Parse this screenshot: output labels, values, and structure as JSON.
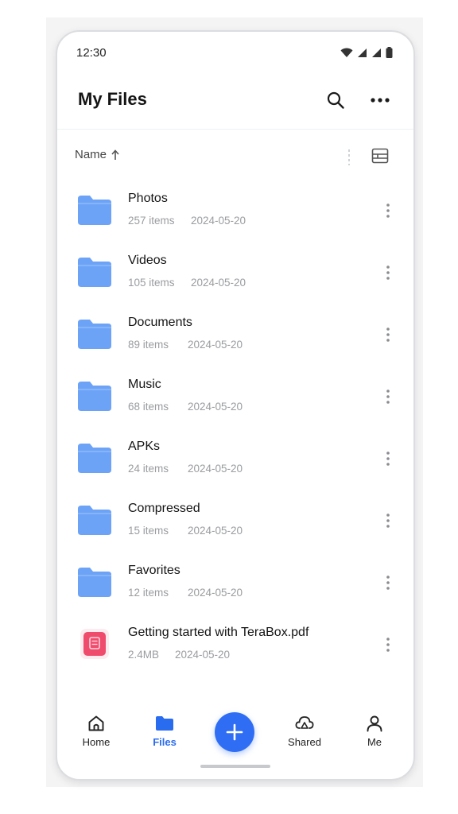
{
  "status_bar": {
    "time": "12:30",
    "icons": [
      "wifi-icon",
      "signal-icon",
      "signal-icon",
      "battery-icon"
    ]
  },
  "header": {
    "title": "My Files",
    "icons": [
      "search-icon",
      "more-horizontal-icon"
    ]
  },
  "sort": {
    "label": "Name",
    "direction_icon": "arrow-up-icon",
    "view_icon": "list-view-icon"
  },
  "files": [
    {
      "name": "Photos",
      "count": "257 items",
      "date": "2024-05-20",
      "type": "folder"
    },
    {
      "name": "Videos",
      "count": "105 items",
      "date": "2024-05-20",
      "type": "folder"
    },
    {
      "name": "Documents",
      "count": "89 items",
      "date": "2024-05-20",
      "type": "folder"
    },
    {
      "name": "Music",
      "count": "68 items",
      "date": "2024-05-20",
      "type": "folder"
    },
    {
      "name": "APKs",
      "count": "24 items",
      "date": "2024-05-20",
      "type": "folder"
    },
    {
      "name": "Compressed",
      "count": "15 items",
      "date": "2024-05-20",
      "type": "folder"
    },
    {
      "name": "Favorites",
      "count": "12 items",
      "date": "2024-05-20",
      "type": "folder"
    },
    {
      "name": "Getting started with TeraBox.pdf",
      "count": "2.4MB",
      "date": "2024-05-20",
      "type": "pdf"
    }
  ],
  "nav": {
    "home": "Home",
    "files": "Files",
    "shared": "Shared",
    "me": "Me",
    "active": "files",
    "fab_icon": "plus-icon"
  },
  "colors": {
    "accent": "#2f6ef4",
    "folder": "#6da3f7",
    "pdf": "#ef4b6c",
    "secondary_text": "#9a9ca0"
  }
}
